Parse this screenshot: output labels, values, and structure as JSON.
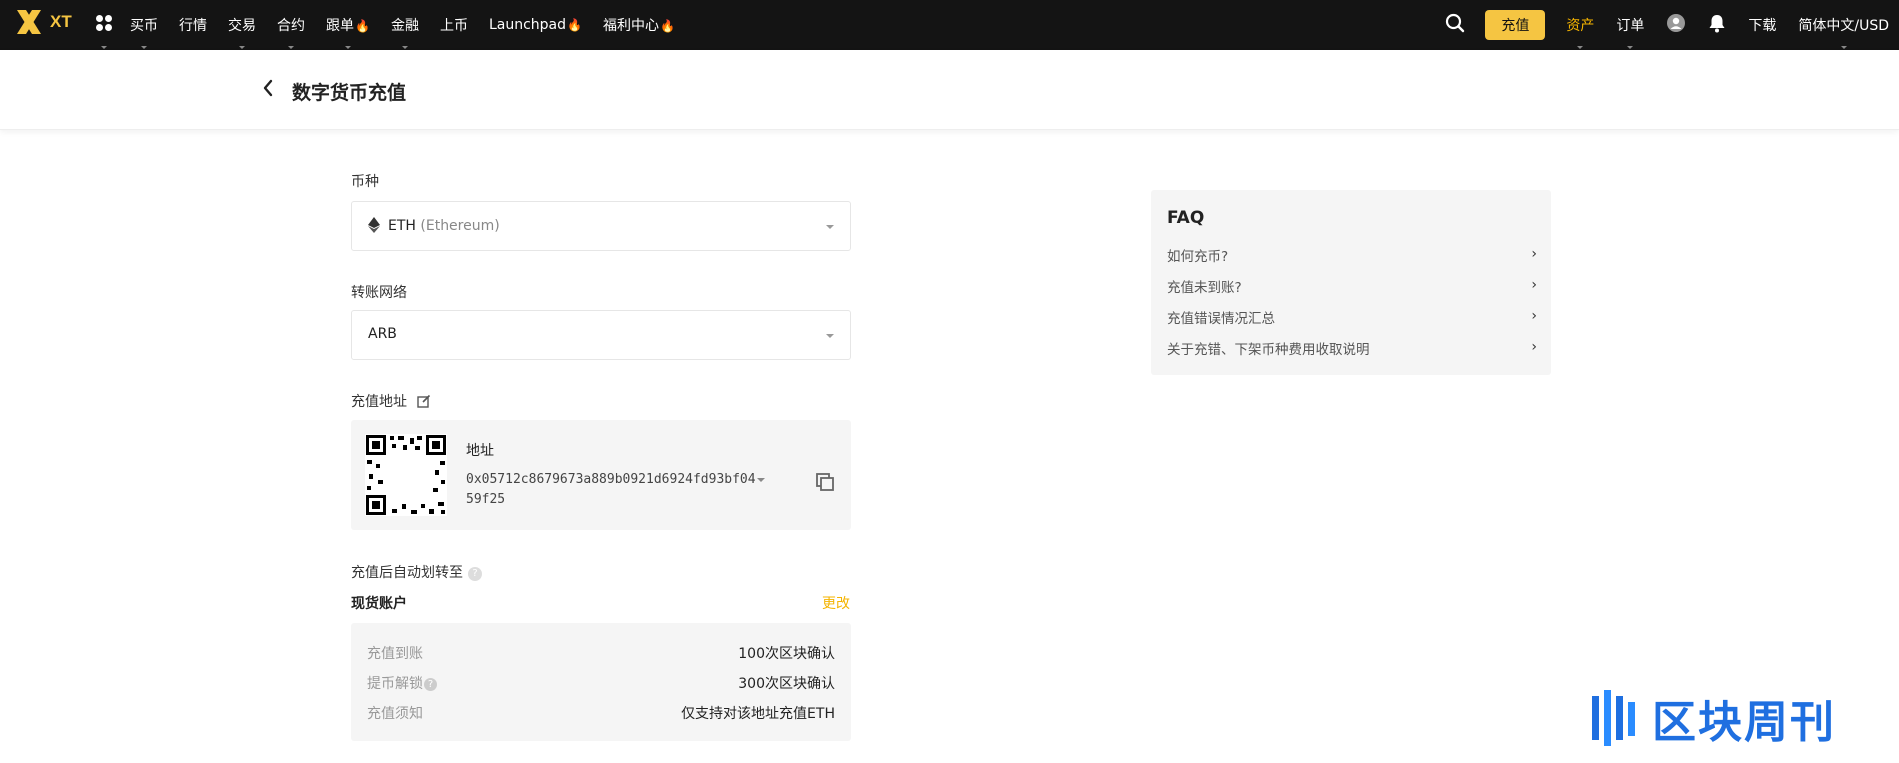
{
  "topbar": {
    "logo": "XT",
    "nav": [
      {
        "label": "买币",
        "caret": true,
        "fire": false
      },
      {
        "label": "行情",
        "caret": false,
        "fire": false
      },
      {
        "label": "交易",
        "caret": true,
        "fire": false
      },
      {
        "label": "合约",
        "caret": true,
        "fire": false
      },
      {
        "label": "跟单",
        "caret": true,
        "fire": true
      },
      {
        "label": "金融",
        "caret": true,
        "fire": false
      },
      {
        "label": "上币",
        "caret": false,
        "fire": false
      },
      {
        "label": "Launchpad",
        "caret": false,
        "fire": true
      },
      {
        "label": "福利中心",
        "caret": false,
        "fire": true
      }
    ],
    "deposit_button": "充值",
    "assets": "资产",
    "orders": "订单",
    "download": "下载",
    "language": "简体中文/USD"
  },
  "header": {
    "title": "数字货币充值"
  },
  "form": {
    "coin_label": "币种",
    "coin_symbol": "ETH",
    "coin_name": "(Ethereum)",
    "network_label": "转账网络",
    "network_value": "ARB",
    "address_label": "充值地址",
    "address_title": "地址",
    "address_value": "0x05712c8679673a889b0921d6924fd93bf0459f25",
    "auto_transfer_label": "充值后自动划转至",
    "account_label": "现货账户",
    "change_label": "更改",
    "info": [
      {
        "key": "充值到账",
        "value": "100次区块确认",
        "help": false
      },
      {
        "key": "提币解锁",
        "value": "300次区块确认",
        "help": true
      },
      {
        "key": "充值须知",
        "value": "仅支持对该地址充值ETH",
        "help": false
      }
    ]
  },
  "faq": {
    "title": "FAQ",
    "items": [
      "如何充币?",
      "充值未到账?",
      "充值错误情况汇总",
      "关于充错、下架币种费用收取说明"
    ]
  },
  "watermark": {
    "text": "区块周刊"
  },
  "colors": {
    "topbar_bg": "#141414",
    "accent": "#f5c542",
    "accent_text": "#f5b400",
    "panel_bg": "#f5f5f5"
  }
}
